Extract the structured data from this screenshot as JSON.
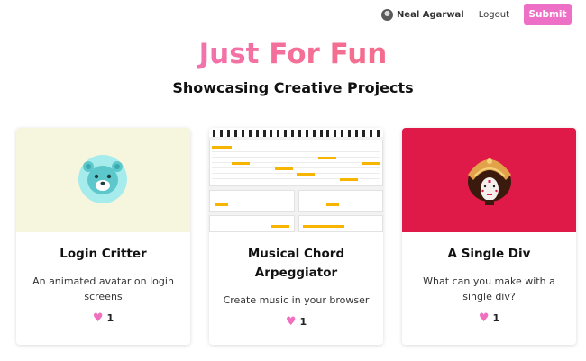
{
  "header": {
    "username": "Neal Agarwal",
    "logout_label": "Logout",
    "submit_label": "Submit"
  },
  "page": {
    "title": "Just For Fun",
    "subtitle": "Showcasing Creative Projects"
  },
  "cards": [
    {
      "title": "Login Critter",
      "description": "An animated avatar on login screens",
      "likes": "1",
      "icon": "bear-face-icon",
      "thumb_color": "#f6f6df"
    },
    {
      "title": "Musical Chord Arpeggiator",
      "description": "Create music in your browser",
      "likes": "1",
      "icon": "arpeggiator-screenshot",
      "thumb_color": "#f2f2f2"
    },
    {
      "title": "A Single Div",
      "description": "What can you make with a single div?",
      "likes": "1",
      "icon": "queen-amidala-icon",
      "thumb_color": "#df1a48"
    }
  ],
  "colors": {
    "accent": "#ee6fc6",
    "heart": "#f06fbe"
  }
}
